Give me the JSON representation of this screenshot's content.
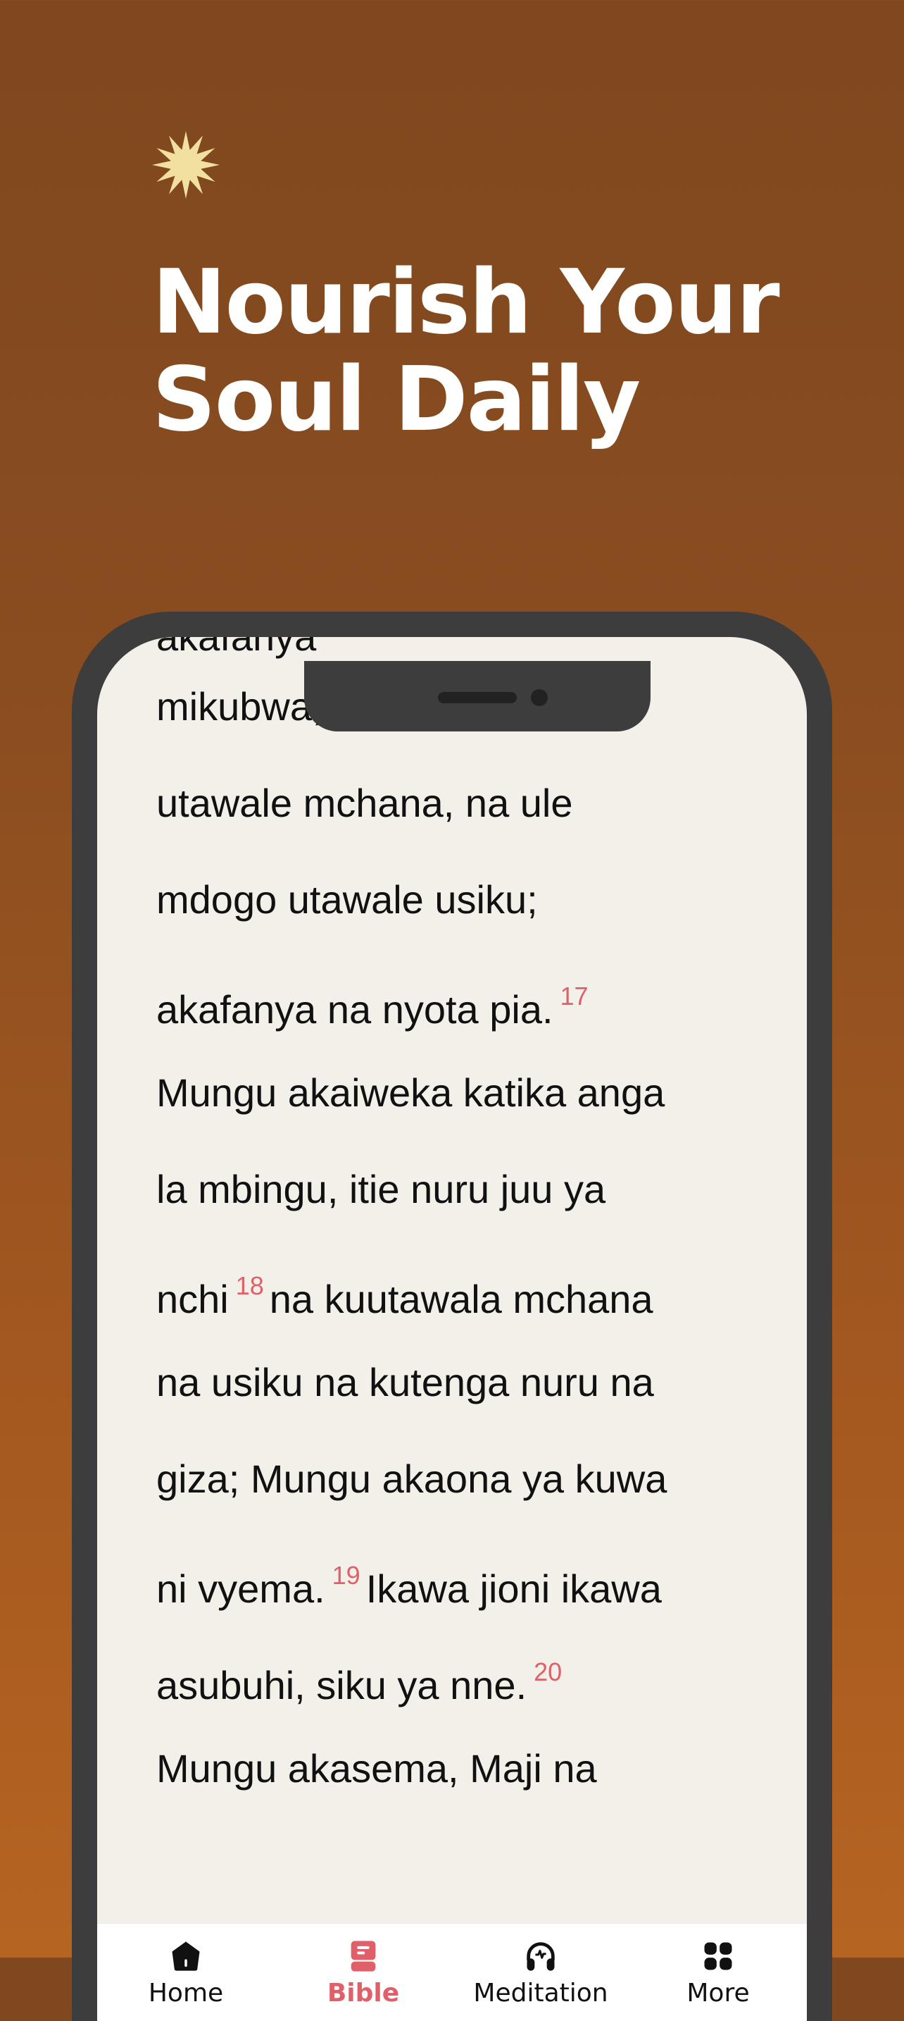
{
  "promo": {
    "headline_line1": "Nourish Your",
    "headline_line2": "Soul Daily",
    "sparkle_icon": "sparkle-icon",
    "sparkle_color": "#f2e0a0",
    "background_colors": [
      "#7f481e",
      "#b66422"
    ]
  },
  "reader": {
    "partial_top_line": "akafanya",
    "lines": [
      {
        "text": "mikubwa, ule mkubwa",
        "verse_after": null,
        "tail": ""
      },
      {
        "text": "utawale mchana, na ule",
        "verse_after": null,
        "tail": ""
      },
      {
        "text": "mdogo utawale usiku;",
        "verse_after": null,
        "tail": ""
      },
      {
        "text": "akafanya na nyota pia.",
        "verse_after": "17",
        "tail": ""
      },
      {
        "text": "Mungu akaiweka katika anga",
        "verse_after": null,
        "tail": ""
      },
      {
        "text": "la mbingu, itie nuru juu ya",
        "verse_after": null,
        "tail": ""
      },
      {
        "text": "nchi",
        "verse_after": "18",
        "tail": "na kuutawala mchana"
      },
      {
        "text": "na usiku na kutenga nuru na",
        "verse_after": null,
        "tail": ""
      },
      {
        "text": "giza; Mungu akaona ya kuwa",
        "verse_after": null,
        "tail": ""
      },
      {
        "text": "ni vyema.",
        "verse_after": "19",
        "tail": "Ikawa jioni ikawa"
      },
      {
        "text": "asubuhi, siku ya nne.",
        "verse_after": "20",
        "tail": ""
      },
      {
        "text": "Mungu akasema, Maji na",
        "verse_after": null,
        "tail": ""
      }
    ],
    "verse_number_color": "#e0606a"
  },
  "tabbar": {
    "active": "Bible",
    "accent_color": "#e0606a",
    "tabs": [
      {
        "label": "Home",
        "icon": "home-icon"
      },
      {
        "label": "Bible",
        "icon": "bible-icon"
      },
      {
        "label": "Meditation",
        "icon": "headphones-icon"
      },
      {
        "label": "More",
        "icon": "grid-icon"
      }
    ]
  }
}
